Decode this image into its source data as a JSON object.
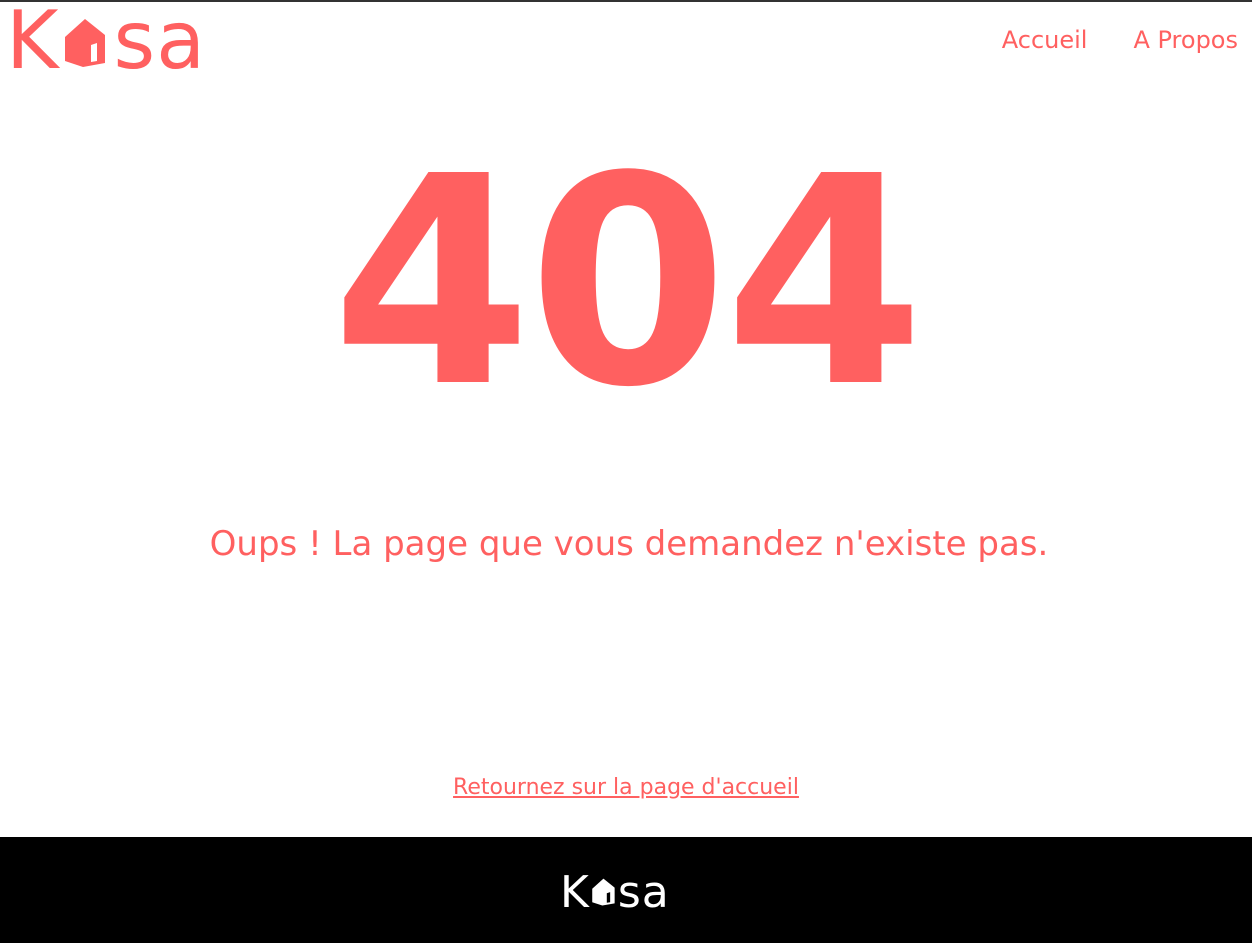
{
  "colors": {
    "accent": "#FF6060",
    "footer_bg": "#000000",
    "footer_text": "#FFFFFF"
  },
  "header": {
    "logo": {
      "part1": "K",
      "part2": "sa",
      "icon": "house-icon"
    },
    "nav": [
      {
        "label": "Accueil"
      },
      {
        "label": "A Propos"
      }
    ]
  },
  "main": {
    "error_code": "404",
    "message": "Oups ! La page que vous demandez n'existe pas.",
    "home_link": "Retournez sur la page d'accueil"
  },
  "footer": {
    "logo": {
      "part1": "K",
      "part2": "sa",
      "icon": "house-icon"
    }
  }
}
